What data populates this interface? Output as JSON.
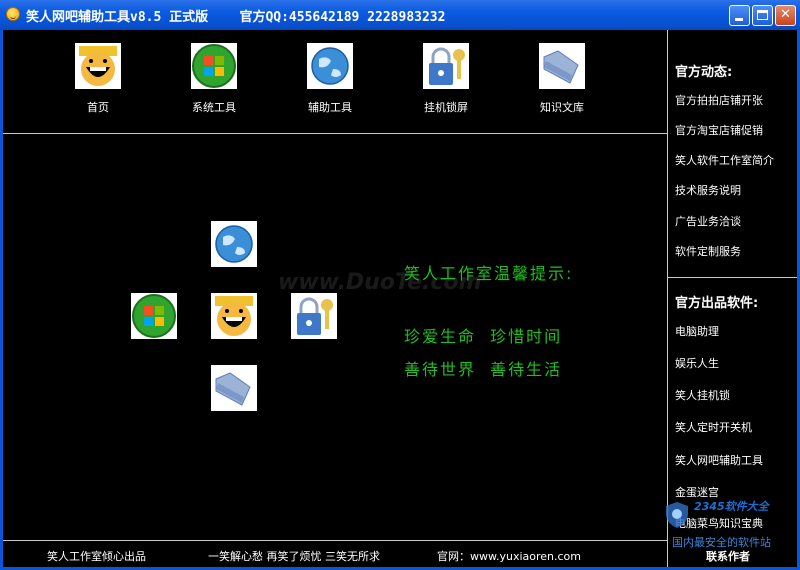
{
  "window": {
    "title": "笑人网吧辅助工具v8.5 正式版    官方QQ:455642189 2228983232"
  },
  "nav": [
    {
      "label": "首页",
      "icon": "smiley-face-icon"
    },
    {
      "label": "系统工具",
      "icon": "windows-logo-icon"
    },
    {
      "label": "辅助工具",
      "icon": "globe-icon"
    },
    {
      "label": "挂机锁屏",
      "icon": "padlock-key-icon"
    },
    {
      "label": "知识文库",
      "icon": "folder-icon"
    }
  ],
  "tips": {
    "heading": "笑人工作室温馨提示:",
    "line1": "珍爱生命  珍惜时间",
    "line2": "善待世界  善待生活"
  },
  "watermark": "www.DuoTe.com",
  "sidebar": {
    "news_heading": "官方动态:",
    "news": [
      "官方拍拍店铺开张",
      "官方淘宝店铺促销",
      "笑人软件工作室简介",
      "技术服务说明",
      "广告业务洽谈",
      "软件定制服务"
    ],
    "software_heading": "官方出品软件:",
    "software": [
      "电脑助理",
      "娱乐人生",
      "笑人挂机锁",
      "笑人定时开关机",
      "笑人网吧辅助工具",
      "金蛋迷宫",
      "电脑菜鸟知识宝典"
    ]
  },
  "footer": {
    "studio": "笑人工作室倾心出品",
    "slogan": "一笑解心愁 再笑了烦忧 三笑无所求",
    "website": "官网：www.yuxiaoren.com",
    "contact": "联系作者"
  },
  "corner_watermark": {
    "logo_text": "2345软件大全",
    "tagline": "国内最安全的软件站"
  },
  "colors": {
    "titlebar": "#0a5ae0",
    "tip_text": "#1fbf1f",
    "background": "#000000"
  }
}
